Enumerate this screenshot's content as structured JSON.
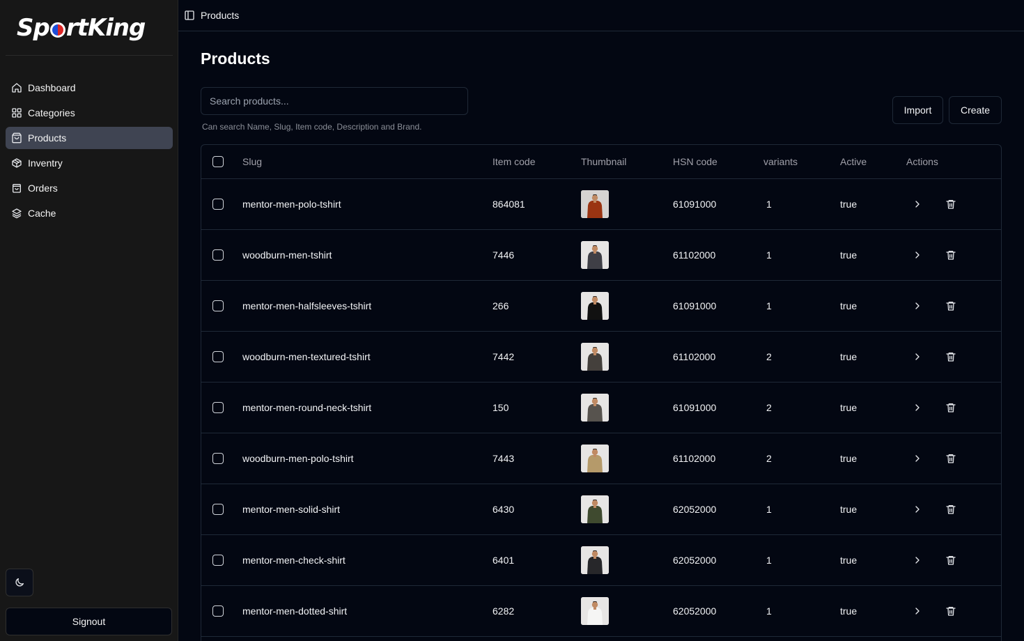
{
  "brand": {
    "logo_left": "Sp",
    "logo_right": "rtKing"
  },
  "sidebar": {
    "items": [
      {
        "label": "Dashboard",
        "icon": "home-icon",
        "active": false
      },
      {
        "label": "Categories",
        "icon": "grid-icon",
        "active": false
      },
      {
        "label": "Products",
        "icon": "shopping-bag-icon",
        "active": true
      },
      {
        "label": "Inventry",
        "icon": "package-icon",
        "active": false
      },
      {
        "label": "Orders",
        "icon": "orders-bag-icon",
        "active": false
      },
      {
        "label": "Cache",
        "icon": "layers-icon",
        "active": false
      }
    ],
    "theme_icon": "moon-icon",
    "signout_label": "Signout"
  },
  "topbar": {
    "toggle_icon": "sidebar-toggle-icon",
    "breadcrumb": "Products"
  },
  "main": {
    "title": "Products",
    "search": {
      "placeholder": "Search products...",
      "value": "",
      "hint": "Can search Name, Slug, Item code, Description and Brand."
    },
    "import_label": "Import",
    "create_label": "Create"
  },
  "table": {
    "columns": [
      "Slug",
      "Item code",
      "Thumbnail",
      "HSN code",
      "variants",
      "Active",
      "Actions"
    ],
    "rows": [
      {
        "slug": "mentor-men-polo-tshirt",
        "item_code": "864081",
        "hsn": "61091000",
        "variants": "1",
        "active": "true",
        "shirt": "#9a3412",
        "bg": "#d6d3d1"
      },
      {
        "slug": "woodburn-men-tshirt",
        "item_code": "7446",
        "hsn": "61102000",
        "variants": "1",
        "active": "true",
        "shirt": "#3f3f46",
        "bg": "#e7e5e4"
      },
      {
        "slug": "mentor-men-halfsleeves-tshirt",
        "item_code": "266",
        "hsn": "61091000",
        "variants": "1",
        "active": "true",
        "shirt": "#111111",
        "bg": "#e7e5e4"
      },
      {
        "slug": "woodburn-men-textured-tshirt",
        "item_code": "7442",
        "hsn": "61102000",
        "variants": "2",
        "active": "true",
        "shirt": "#44403c",
        "bg": "#e7e5e4"
      },
      {
        "slug": "mentor-men-round-neck-tshirt",
        "item_code": "150",
        "hsn": "61091000",
        "variants": "2",
        "active": "true",
        "shirt": "#57534e",
        "bg": "#e7e5e4"
      },
      {
        "slug": "woodburn-men-polo-tshirt",
        "item_code": "7443",
        "hsn": "61102000",
        "variants": "2",
        "active": "true",
        "shirt": "#b59a6a",
        "bg": "#e7e5e4"
      },
      {
        "slug": "mentor-men-solid-shirt",
        "item_code": "6430",
        "hsn": "62052000",
        "variants": "1",
        "active": "true",
        "shirt": "#3f4a2f",
        "bg": "#e7e5e4"
      },
      {
        "slug": "mentor-men-check-shirt",
        "item_code": "6401",
        "hsn": "62052000",
        "variants": "1",
        "active": "true",
        "shirt": "#27272a",
        "bg": "#e7e5e4"
      },
      {
        "slug": "mentor-men-dotted-shirt",
        "item_code": "6282",
        "hsn": "62052000",
        "variants": "1",
        "active": "true",
        "shirt": "#f5f5f4",
        "bg": "#e7e5e4"
      }
    ],
    "row_actions": {
      "open_icon": "chevron-right-icon",
      "delete_icon": "trash-icon"
    }
  }
}
